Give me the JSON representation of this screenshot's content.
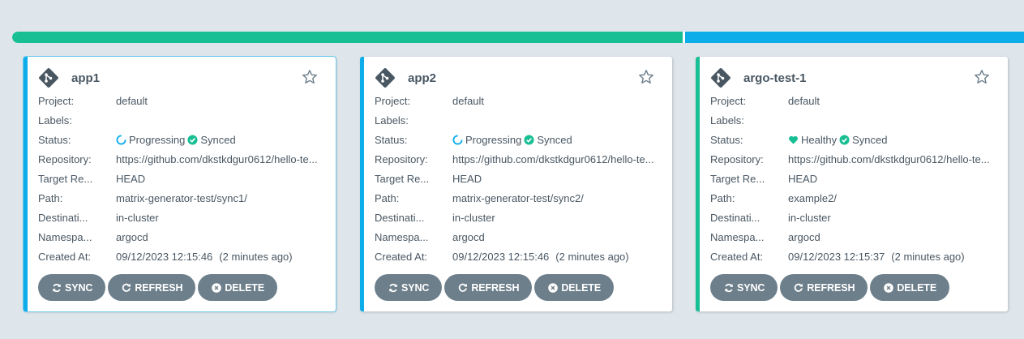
{
  "status_bar": {
    "healthy_fraction": 0.667,
    "progressing_fraction": 0.333,
    "colors": {
      "healthy": "#18be94",
      "progressing": "#0dadea"
    }
  },
  "labels": {
    "project": "Project:",
    "labels": "Labels:",
    "status": "Status:",
    "repository": "Repository:",
    "target_revision": "Target Re...",
    "path": "Path:",
    "destination": "Destinati...",
    "namespace": "Namespa...",
    "created_at": "Created At:"
  },
  "buttons": {
    "sync": "SYNC",
    "refresh": "REFRESH",
    "delete": "DELETE"
  },
  "apps": [
    {
      "name": "app1",
      "project": "default",
      "labels": "",
      "health": "Progressing",
      "health_icon": "progressing-icon",
      "sync": "Synced",
      "repository": "https://github.com/dkstkdgur0612/hello-te...",
      "target_revision": "HEAD",
      "path": "matrix-generator-test/sync1/",
      "destination": "in-cluster",
      "namespace": "argocd",
      "created_at": "09/12/2023 12:15:46",
      "created_relative": "(2 minutes ago)"
    },
    {
      "name": "app2",
      "project": "default",
      "labels": "",
      "health": "Progressing",
      "health_icon": "progressing-icon",
      "sync": "Synced",
      "repository": "https://github.com/dkstkdgur0612/hello-te...",
      "target_revision": "HEAD",
      "path": "matrix-generator-test/sync2/",
      "destination": "in-cluster",
      "namespace": "argocd",
      "created_at": "09/12/2023 12:15:46",
      "created_relative": "(2 minutes ago)"
    },
    {
      "name": "argo-test-1",
      "project": "default",
      "labels": "",
      "health": "Healthy",
      "health_icon": "heart-icon",
      "sync": "Synced",
      "repository": "https://github.com/dkstkdgur0612/hello-te...",
      "target_revision": "HEAD",
      "path": "example2/",
      "destination": "in-cluster",
      "namespace": "argocd",
      "created_at": "09/12/2023 12:15:37",
      "created_relative": "(2 minutes ago)"
    }
  ]
}
